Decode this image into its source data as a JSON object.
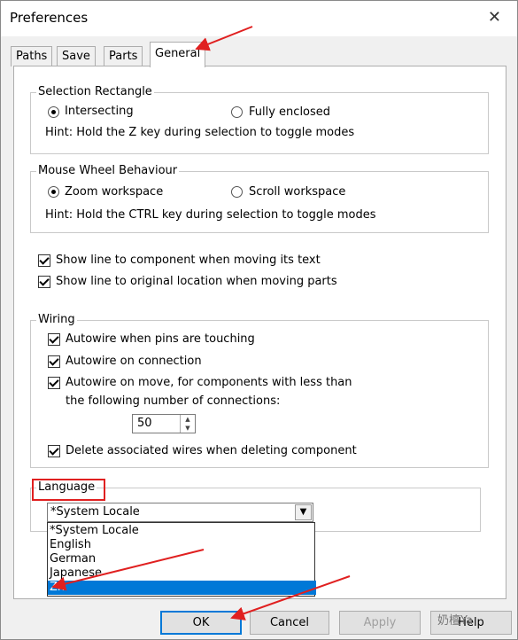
{
  "window": {
    "title": "Preferences",
    "close_glyph": "✕"
  },
  "tabs": [
    {
      "label": "Paths"
    },
    {
      "label": "Save"
    },
    {
      "label": "Parts"
    },
    {
      "label": "General"
    }
  ],
  "selection_rectangle": {
    "label": "Selection Rectangle",
    "option_intersecting": "Intersecting",
    "option_fully_enclosed": "Fully enclosed",
    "selected": "Intersecting",
    "hint": "Hint: Hold the Z key during selection to toggle modes"
  },
  "mouse_wheel": {
    "label": "Mouse Wheel Behaviour",
    "option_zoom": "Zoom workspace",
    "option_scroll": "Scroll workspace",
    "selected": "Zoom workspace",
    "hint": "Hint: Hold the CTRL key during selection to toggle modes"
  },
  "display_options": {
    "show_line_component": "Show line to component when moving its text",
    "show_line_original": "Show line to original location when moving parts"
  },
  "wiring": {
    "label": "Wiring",
    "autowire_touching": "Autowire when pins are touching",
    "autowire_connection": "Autowire on connection",
    "autowire_move_line1": "Autowire on move, for components with less than",
    "autowire_move_line2": "the following number of connections:",
    "connections_value": "50",
    "delete_wires": "Delete associated wires when deleting component"
  },
  "language": {
    "label": "Language",
    "selected": "*System Locale",
    "options": [
      "*System Locale",
      "English",
      "German",
      "Japanese",
      "Zh"
    ],
    "highlighted": "Zh"
  },
  "buttons": {
    "ok": "OK",
    "cancel": "Cancel",
    "apply": "Apply",
    "help": "Help"
  },
  "watermark": "奶檀Ya",
  "colors": {
    "accent": "#0078d7",
    "annotation": "#e02020"
  }
}
